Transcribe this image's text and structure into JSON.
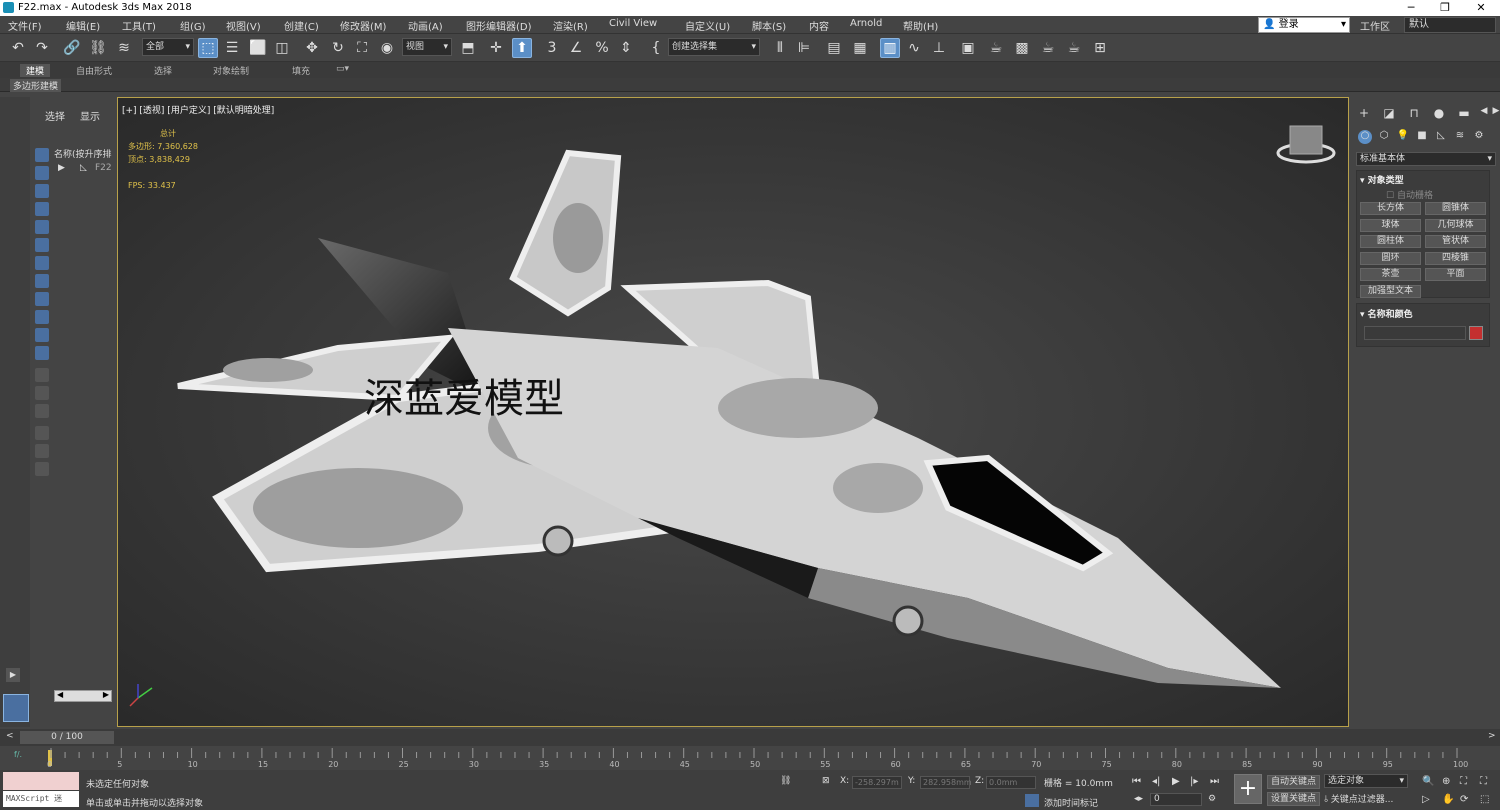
{
  "window": {
    "title": "F22.max - Autodesk 3ds Max 2018"
  },
  "menu": [
    "文件(F)",
    "编辑(E)",
    "工具(T)",
    "组(G)",
    "视图(V)",
    "创建(C)",
    "修改器(M)",
    "动画(A)",
    "图形编辑器(D)",
    "渲染(R)",
    "Civil View",
    "自定义(U)",
    "脚本(S)",
    "内容",
    "Arnold",
    "帮助(H)"
  ],
  "account": {
    "login": "登录",
    "workspace_label": "工作区",
    "workspace_value": "默认"
  },
  "toolbar": {
    "selection_filter": "全部",
    "ref_coord": "视图",
    "named_sel": "创建选择集"
  },
  "ribbon": {
    "tabs": [
      "建模",
      "自由形式",
      "选择",
      "对象绘制",
      "填充"
    ],
    "sub": "多边形建模"
  },
  "scene_explorer": {
    "tab_select": "选择",
    "tab_display": "显示",
    "column": "名称(按升序排",
    "item": "F22"
  },
  "viewport": {
    "label": "[+] [透视] [用户定义] [默认明暗处理]",
    "stats": {
      "total": "总计",
      "poly_label": "多边形:",
      "poly": "7,360,628",
      "vert_label": "顶点:",
      "vert": "3,838,429",
      "fps_label": "FPS:",
      "fps": "33.437"
    },
    "watermark": "深蓝爱模型"
  },
  "command_panel": {
    "category": "标准基本体",
    "object_type_title": "对象类型",
    "autogrid": "自动栅格",
    "buttons": [
      "长方体",
      "圆锥体",
      "球体",
      "几何球体",
      "圆柱体",
      "管状体",
      "圆环",
      "四棱锥",
      "茶壶",
      "平面",
      "加强型文本"
    ],
    "name_color_title": "名称和颜色"
  },
  "timeline": {
    "slider": "0 / 100",
    "ticks": [
      "0",
      "5",
      "10",
      "15",
      "20",
      "25",
      "30",
      "35",
      "40",
      "45",
      "50",
      "55",
      "60",
      "65",
      "70",
      "75",
      "80",
      "85",
      "90",
      "95",
      "100"
    ]
  },
  "status": {
    "maxscript": "MAXScript 迷",
    "line1": "未选定任何对象",
    "line2": "单击或单击并拖动以选择对象",
    "x_label": "X:",
    "x": "-258.297m",
    "y_label": "Y:",
    "y": "282.958mm",
    "z_label": "Z:",
    "z": "0.0mm",
    "grid": "栅格 = 10.0mm",
    "add_time_tag": "添加时间标记",
    "auto_key": "自动关键点",
    "set_key": "设置关键点",
    "selected_obj": "选定对象",
    "key_filters": "关键点过滤器...",
    "frame": "0"
  },
  "colors": {
    "accent": "#5b8fc7",
    "viewport_border": "#b8a14a",
    "stats": "#e0c24a",
    "object_color": "#c42f2f"
  }
}
